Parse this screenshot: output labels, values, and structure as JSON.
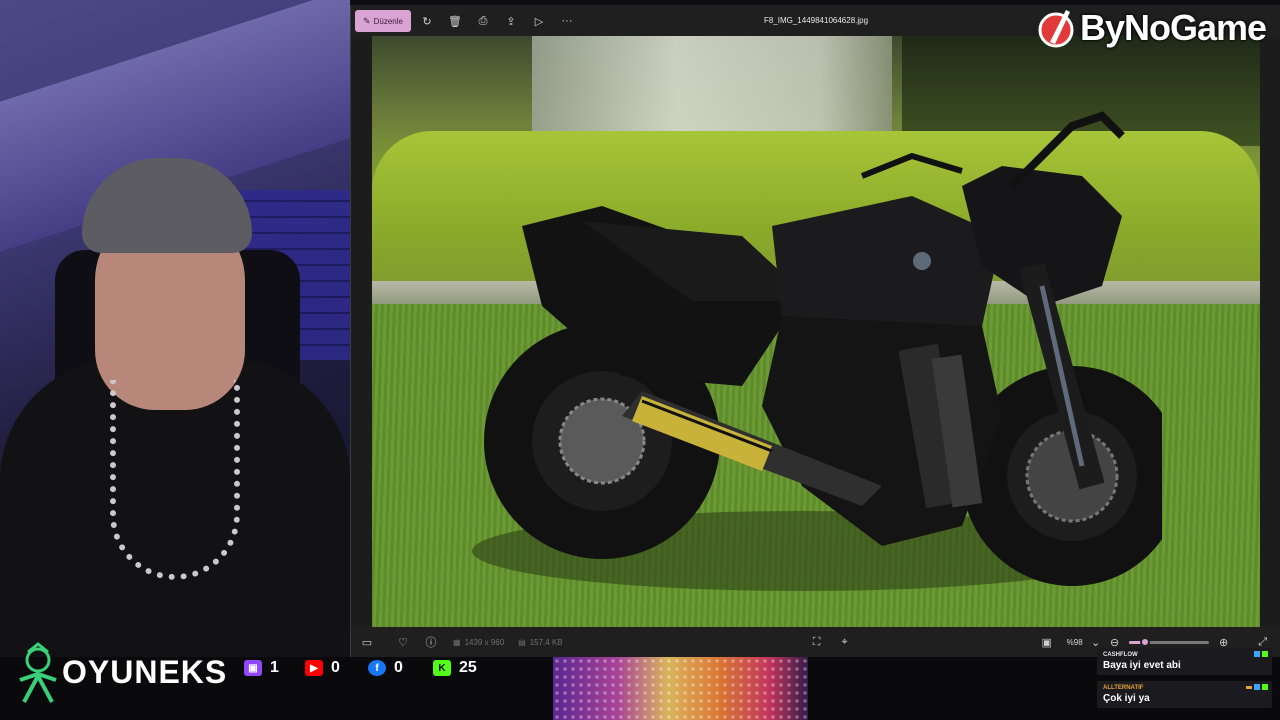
{
  "viewer": {
    "edit_label": "Düzenle",
    "filename": "F8_IMG_1449841064628.jpg",
    "toolbar_icons": [
      "edit-icon",
      "rotate-icon",
      "delete-icon",
      "print-icon",
      "share-icon",
      "slideshow-icon",
      "more-icon"
    ],
    "dimensions": "1439 x 960",
    "file_size": "157.4 KB",
    "zoom": "%98",
    "zoom_level": 0.2,
    "accent": "#d9a4d4"
  },
  "brand": {
    "name": "ByNoGame",
    "color": "#ffffff",
    "accent": "#e03a3a"
  },
  "stream": {
    "channel": "OYUNEKS",
    "stats": [
      {
        "platform": "twitch-icon",
        "count": "1",
        "color": "#9146ff"
      },
      {
        "platform": "youtube-icon",
        "count": "0",
        "color": "#ff0000"
      },
      {
        "platform": "facebook-icon",
        "count": "0",
        "color": "#1877f2"
      },
      {
        "platform": "kick-icon",
        "count": "25",
        "color": "#53fc18"
      }
    ]
  },
  "chat": {
    "messages": [
      {
        "user": "CASHFLOW",
        "text": "Baya iyi evet abi",
        "user_color": "#e6e6e6"
      },
      {
        "user": "ALLTERNATIF",
        "text": "Çok iyi ya",
        "user_color": "#e8a23a"
      }
    ]
  }
}
